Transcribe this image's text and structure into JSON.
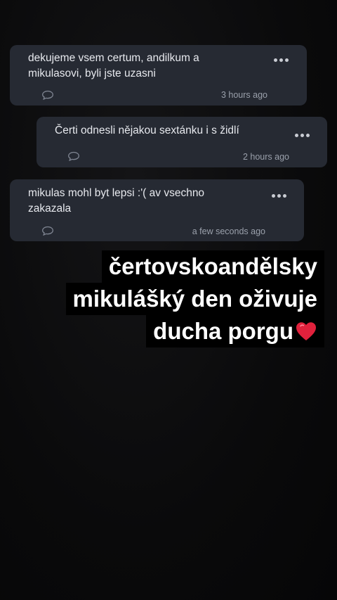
{
  "comments": [
    {
      "text": "dekujeme vsem certum, andilkum a\nmikulasovi, byli jste uzasni",
      "time": "3 hours ago"
    },
    {
      "text": "Čerti odnesli nějakou sextánku i s židlí",
      "time": "2 hours ago"
    },
    {
      "text": "mikulas mohl byt lepsi :'( av vsechno\nzakazala",
      "time": "a few seconds ago"
    }
  ],
  "caption": {
    "line1": "čertovskoandělsky",
    "line2": "mikulášký den oživuje",
    "line3": "ducha porgu"
  },
  "colors": {
    "card_bg": "#262a33",
    "background": "#0b0b0c",
    "heart": "#e0213c"
  },
  "icons": [
    "more-options-icon",
    "reply-bubble-icon",
    "heart-icon"
  ]
}
